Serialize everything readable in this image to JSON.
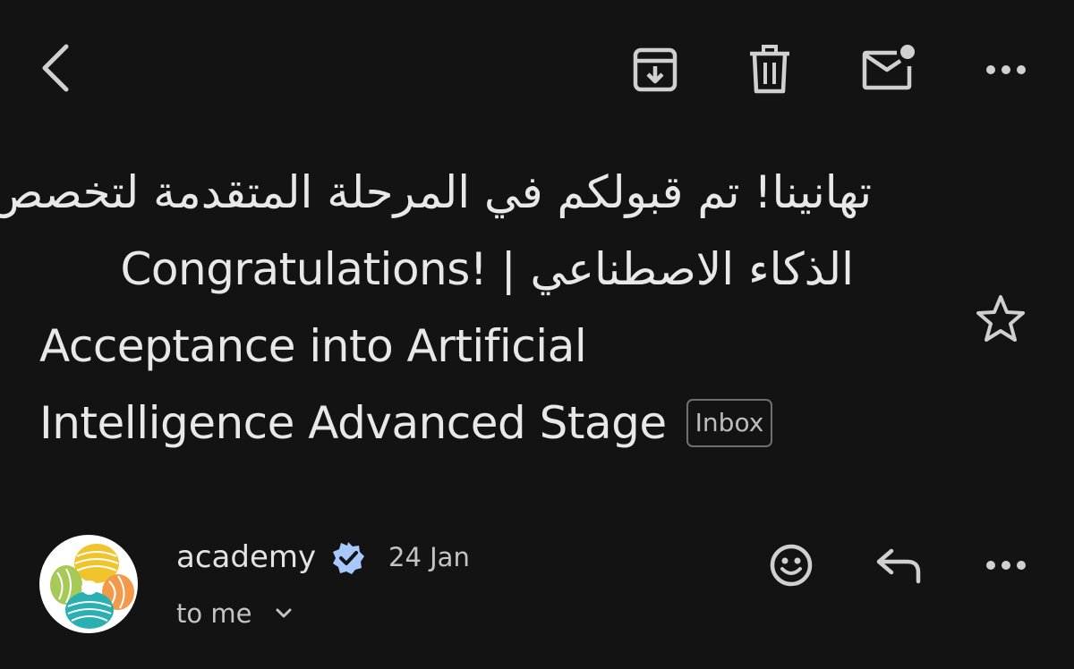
{
  "toolbar": {
    "back_icon": "chevron-left-icon",
    "archive_icon": "archive-icon",
    "delete_icon": "trash-icon",
    "mark_unread_icon": "mail-unread-icon",
    "more_icon": "more-horizontal-icon"
  },
  "email": {
    "subject_lines": [
      "تهانينا! تم قبولكم في المرحلة المتقدمة لتخصص",
      "الذكاء الاصطناعي |",
      "Congratulations!",
      "Acceptance into Artificial",
      "Intelligence Advanced Stage"
    ],
    "label": "Inbox",
    "star_icon": "star-outline-icon"
  },
  "sender": {
    "name": "academy",
    "verified_icon": "verified-badge-icon",
    "date": "24 Jan",
    "recipient": "to me",
    "expand_icon": "chevron-down-icon",
    "actions": {
      "emoji_icon": "emoji-react-icon",
      "reply_icon": "reply-icon",
      "more_icon": "more-horizontal-icon"
    }
  },
  "colors": {
    "background": "#131314",
    "text": "#e3e3e3",
    "verified_badge": "#a8c7fa"
  }
}
